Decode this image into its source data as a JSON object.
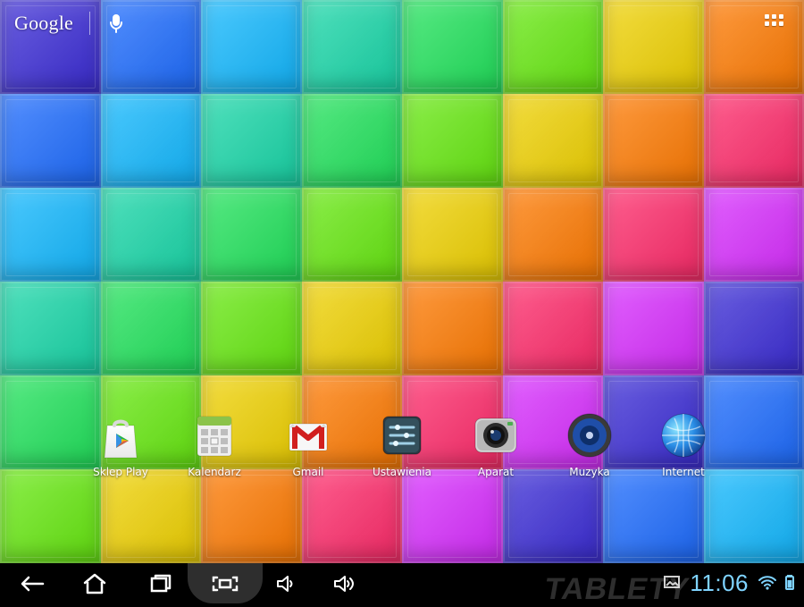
{
  "top_bar": {
    "search_brand": "Google"
  },
  "apps": [
    {
      "label": "Sklep Play",
      "icon": "play-store-icon"
    },
    {
      "label": "Kalendarz",
      "icon": "calendar-icon"
    },
    {
      "label": "Gmail",
      "icon": "gmail-icon"
    },
    {
      "label": "Ustawienia",
      "icon": "settings-icon"
    },
    {
      "label": "Aparat",
      "icon": "camera-icon"
    },
    {
      "label": "Muzyka",
      "icon": "music-icon"
    },
    {
      "label": "Internet",
      "icon": "browser-icon"
    }
  ],
  "navbar": {
    "clock": "11:06",
    "watermark": "TABLETY"
  },
  "colors": {
    "wallpaper_palette": [
      "#3a2bd6",
      "#1c6bff",
      "#11b8ff",
      "#17d7a8",
      "#20e35b",
      "#66e90f",
      "#f0d200",
      "#ff7a00",
      "#ff2a6a",
      "#d82cff"
    ],
    "clock": "#7fd3ff",
    "nav_background": "#000000"
  }
}
